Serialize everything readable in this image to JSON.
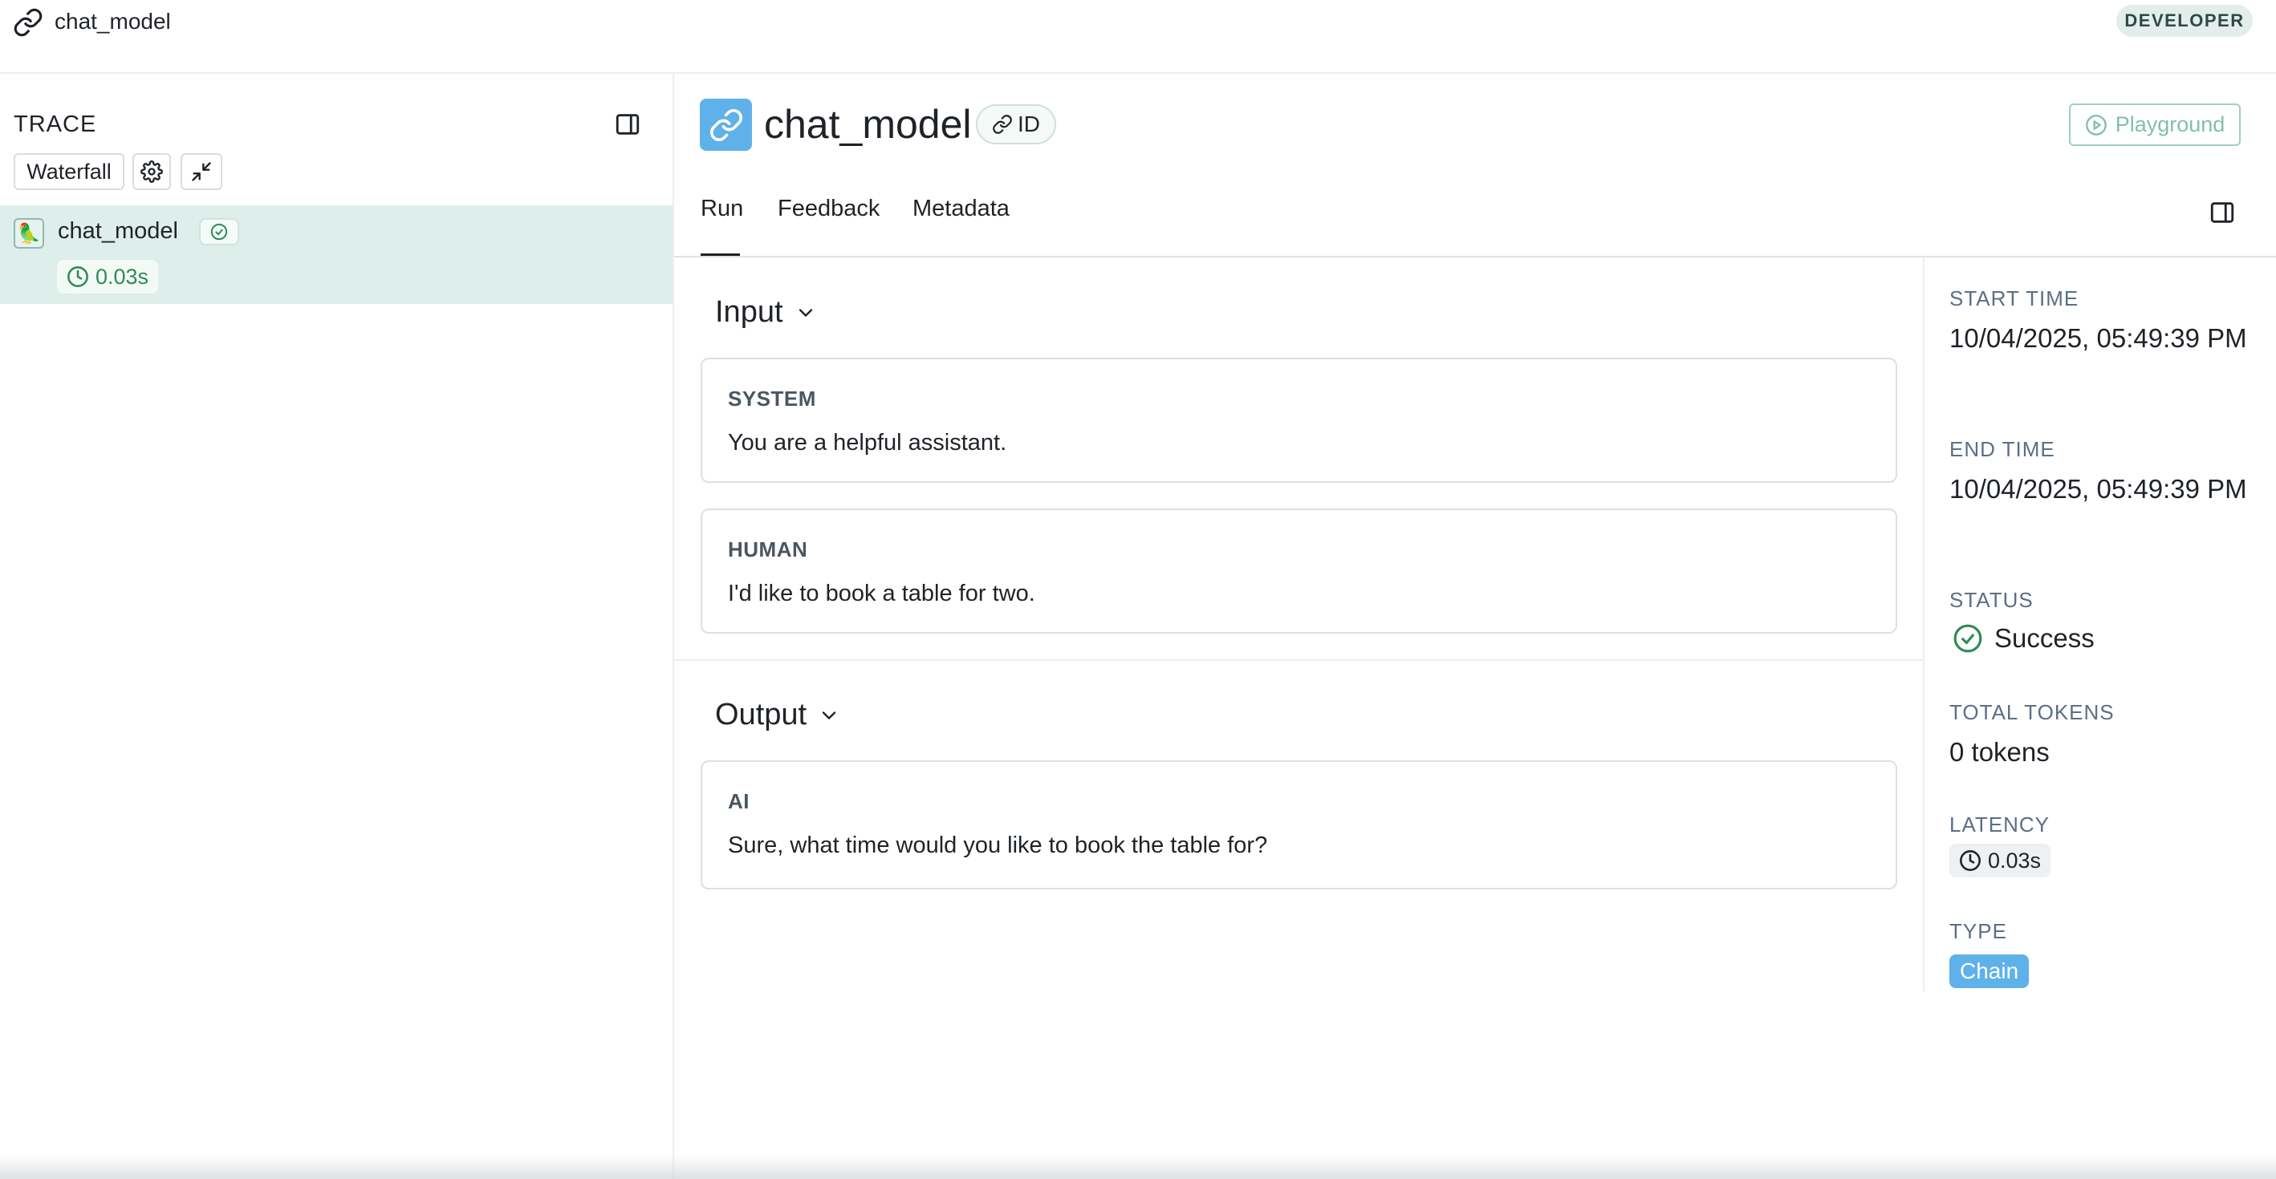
{
  "topbar": {
    "title": "chat_model",
    "badge": "DEVELOPER"
  },
  "trace_panel": {
    "heading": "TRACE",
    "waterfall_label": "Waterfall",
    "run": {
      "name": "chat_model",
      "latency": "0.03s"
    }
  },
  "run_header": {
    "title": "chat_model",
    "id_label": "ID",
    "playground_label": "Playground"
  },
  "tabs": [
    {
      "label": "Run",
      "active": true
    },
    {
      "label": "Feedback",
      "active": false
    },
    {
      "label": "Metadata",
      "active": false
    }
  ],
  "input": {
    "title": "Input",
    "messages": [
      {
        "role": "SYSTEM",
        "text": "You are a helpful assistant."
      },
      {
        "role": "HUMAN",
        "text": "I'd like to book a table for two."
      }
    ]
  },
  "output": {
    "title": "Output",
    "messages": [
      {
        "role": "AI",
        "text": "Sure, what time would you like to book the table for?"
      }
    ]
  },
  "details": {
    "start_time_label": "START TIME",
    "start_time": "10/04/2025, 05:49:39 PM",
    "end_time_label": "END TIME",
    "end_time": "10/04/2025, 05:49:39 PM",
    "status_label": "STATUS",
    "status": "Success",
    "tokens_label": "TOTAL TOKENS",
    "tokens": "0 tokens",
    "latency_label": "LATENCY",
    "latency": "0.03s",
    "type_label": "TYPE",
    "type": "Chain"
  },
  "colors": {
    "accent_blue": "#5fb1e9",
    "success_green": "#2e8b57",
    "selected_row": "#deeeeb"
  }
}
